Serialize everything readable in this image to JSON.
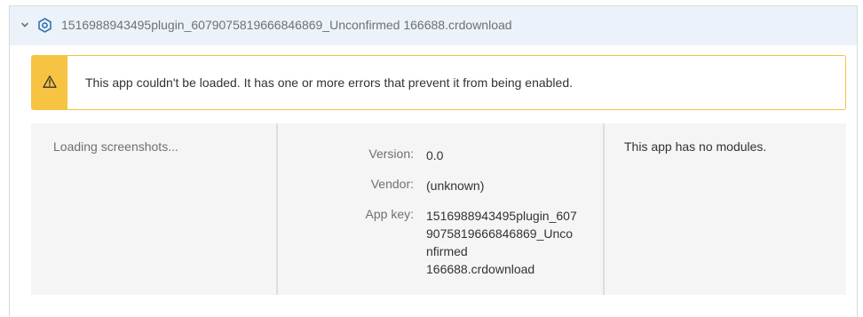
{
  "header": {
    "title": "1516988943495plugin_6079075819666846869_Unconfirmed 166688.crdownload",
    "chevron_icon": "chevron-down-icon",
    "plugin_icon": "plugin-gear-icon"
  },
  "warning": {
    "message": "This app couldn't be loaded. It has one or more errors that prevent it from being enabled.",
    "icon": "warning-triangle-icon",
    "color": "#f6c342"
  },
  "screenshots": {
    "loading_text": "Loading screenshots..."
  },
  "info": {
    "version_label": "Version:",
    "version_value": "0.0",
    "vendor_label": "Vendor:",
    "vendor_value": "(unknown)",
    "app_key_label": "App key:",
    "app_key_lines": [
      "1516988943495plugin_607",
      "9075819666846869_Unco",
      "nfirmed",
      "166688.crdownload"
    ]
  },
  "modules": {
    "text": "This app has no modules."
  },
  "colors": {
    "header_bg": "#ebf2f9",
    "accent_blue": "#3572b0",
    "warning_yellow": "#f6c342",
    "panel_bg": "#f5f5f5"
  }
}
